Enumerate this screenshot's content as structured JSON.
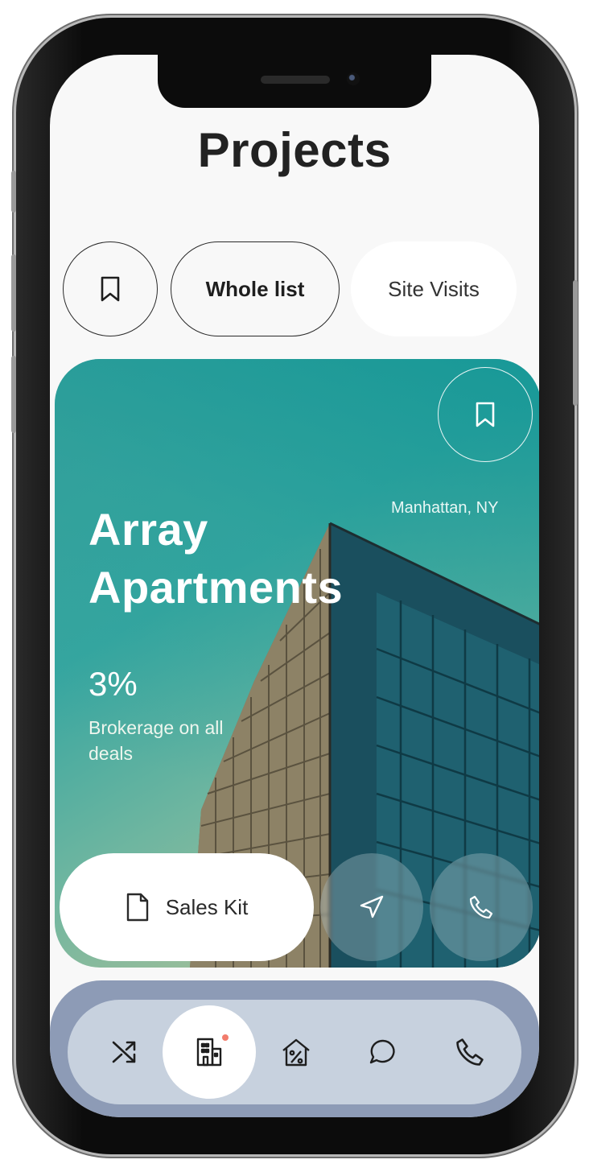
{
  "header": {
    "title": "Projects"
  },
  "filters": {
    "bookmark_icon": "bookmark-icon",
    "whole_list": "Whole list",
    "site_visits": "Site Visits"
  },
  "project": {
    "location": "Manhattan, NY",
    "title_line1": "Array",
    "title_line2": "Apartments",
    "brokerage_value": "3%",
    "brokerage_text": "Brokerage on all deals",
    "sales_kit_label": "Sales Kit"
  },
  "bottom_nav": {
    "items": [
      "shuffle-icon",
      "building-icon",
      "house-percent-icon",
      "chat-icon",
      "phone-icon"
    ],
    "active": "building-icon"
  },
  "colors": {
    "card_teal": "#37a6a0",
    "nav_bar": "#8d9bb6",
    "nav_inner": "#c7d1de",
    "notification_dot": "#f27c6c"
  }
}
